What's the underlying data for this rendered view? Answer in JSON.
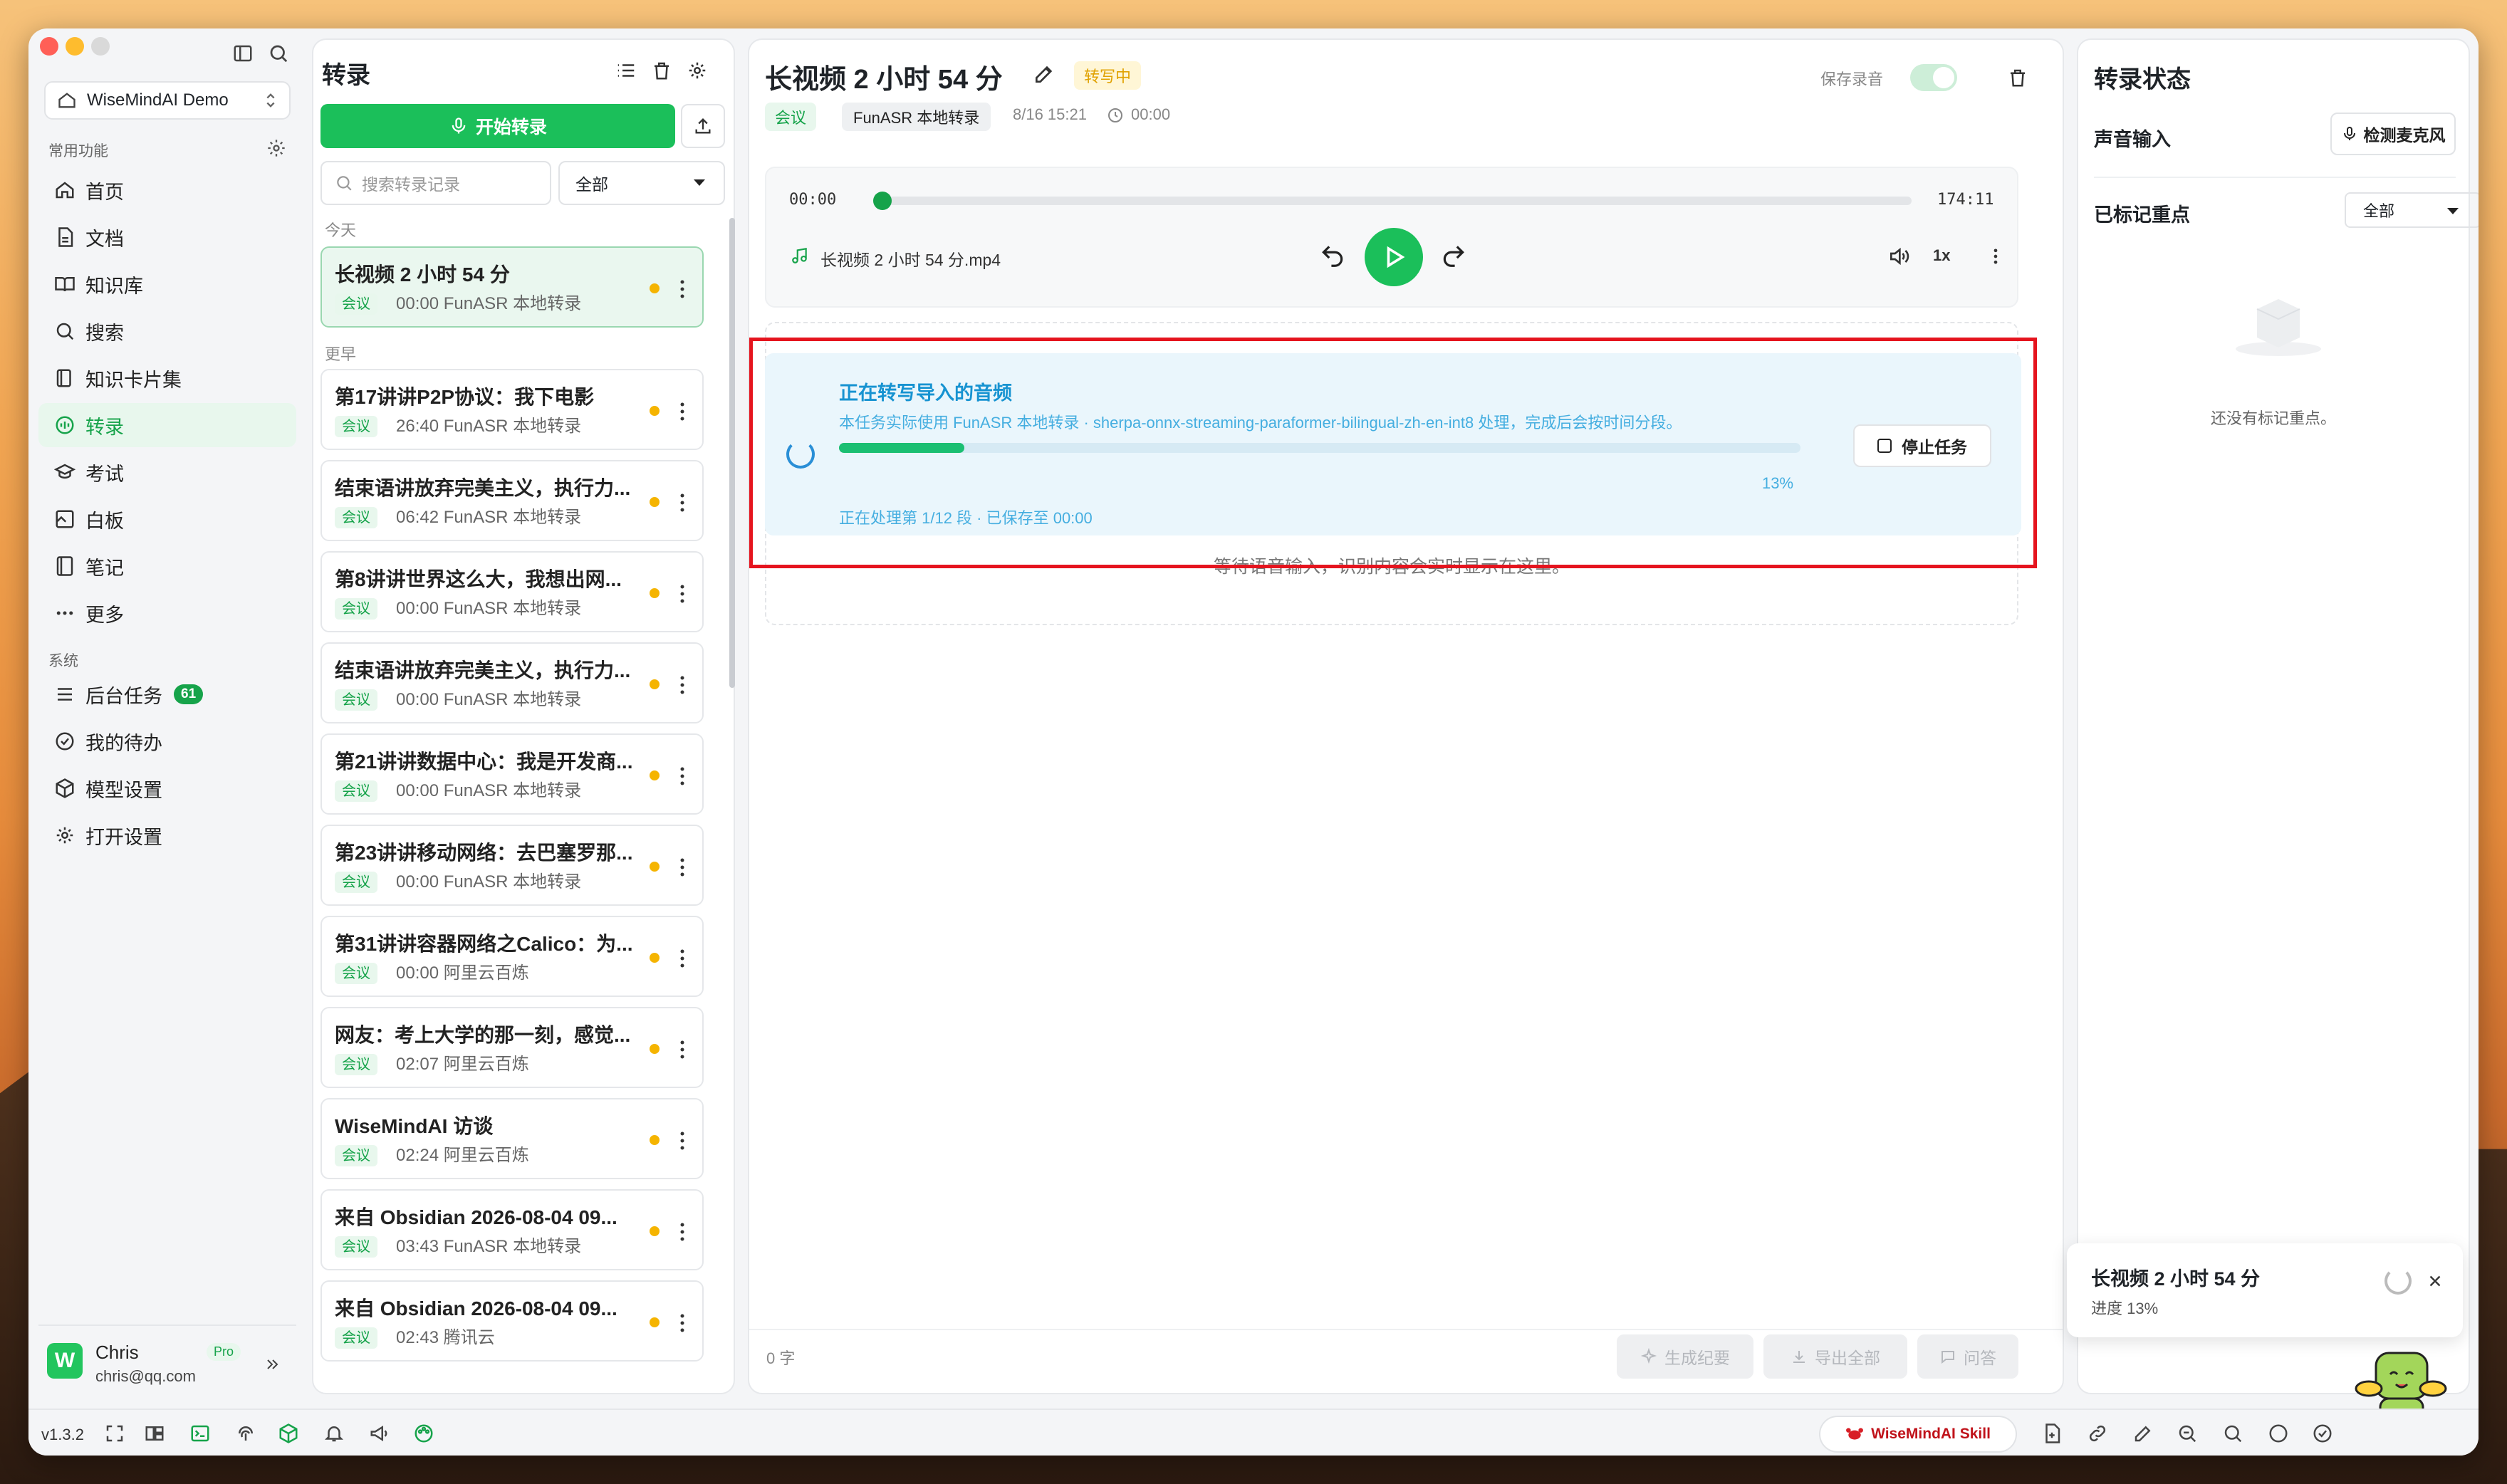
{
  "window": {
    "brand_colors": {
      "accent": "#16a34a",
      "highlight": "#e5141e",
      "warning": "#f5b400",
      "progress": "#1bbf72"
    }
  },
  "sidebar": {
    "workspace": "WiseMindAI Demo",
    "section_common": "常用功能",
    "items": [
      {
        "label": "首页",
        "icon": "home-icon"
      },
      {
        "label": "文档",
        "icon": "document-icon"
      },
      {
        "label": "知识库",
        "icon": "book-icon"
      },
      {
        "label": "搜索",
        "icon": "search-icon"
      },
      {
        "label": "知识卡片集",
        "icon": "card-icon"
      },
      {
        "label": "转录",
        "icon": "transcribe-icon",
        "active": true
      },
      {
        "label": "考试",
        "icon": "exam-icon"
      },
      {
        "label": "白板",
        "icon": "whiteboard-icon"
      },
      {
        "label": "笔记",
        "icon": "notebook-icon"
      },
      {
        "label": "更多",
        "icon": "more-icon"
      }
    ],
    "section_system": "系统",
    "system_items": [
      {
        "label": "后台任务",
        "icon": "list-icon",
        "badge": "61"
      },
      {
        "label": "我的待办",
        "icon": "check-circle-icon"
      },
      {
        "label": "模型设置",
        "icon": "cube-icon"
      },
      {
        "label": "打开设置",
        "icon": "gear-icon"
      }
    ],
    "user": {
      "name": "Chris",
      "email": "chris@qq.com",
      "plan": "Pro"
    }
  },
  "list": {
    "title": "转录",
    "start_button": "开始转录",
    "search_placeholder": "搜索转录记录",
    "filter": "全部",
    "group_today": "今天",
    "group_earlier": "更早",
    "today": [
      {
        "title": "长视频 2 小时 54 分",
        "tag": "会议",
        "meta": "00:00   FunASR 本地转录"
      }
    ],
    "earlier": [
      {
        "title": "第17讲讲P2P协议：我下电影",
        "tag": "会议",
        "meta": "26:40   FunASR 本地转录"
      },
      {
        "title": "结束语讲放弃完美主义，执行力...",
        "tag": "会议",
        "meta": "06:42   FunASR 本地转录"
      },
      {
        "title": "第8讲讲世界这么大，我想出网...",
        "tag": "会议",
        "meta": "00:00   FunASR 本地转录"
      },
      {
        "title": "结束语讲放弃完美主义，执行力...",
        "tag": "会议",
        "meta": "00:00   FunASR 本地转录"
      },
      {
        "title": "第21讲讲数据中心：我是开发商...",
        "tag": "会议",
        "meta": "00:00   FunASR 本地转录"
      },
      {
        "title": "第23讲讲移动网络：去巴塞罗那...",
        "tag": "会议",
        "meta": "00:00   FunASR 本地转录"
      },
      {
        "title": "第31讲讲容器网络之Calico：为...",
        "tag": "会议",
        "meta": "00:00   阿里云百炼"
      },
      {
        "title": "网友：考上大学的那一刻，感觉...",
        "tag": "会议",
        "meta": "02:07   阿里云百炼"
      },
      {
        "title": "WiseMindAI 访谈",
        "tag": "会议",
        "meta": "02:24   阿里云百炼"
      },
      {
        "title": "来自 Obsidian 2026-08-04 09...",
        "tag": "会议",
        "meta": "03:43   FunASR 本地转录"
      },
      {
        "title": "来自 Obsidian 2026-08-04 09...",
        "tag": "会议",
        "meta": "02:43   腾讯云"
      }
    ]
  },
  "main": {
    "title": "长视频 2 小时 54 分",
    "status": "转写中",
    "tag": "会议",
    "engine": "FunASR 本地转录",
    "date": "8/16 15:21",
    "duration": "00:00",
    "save_audio_label": "保存录音",
    "player": {
      "current": "00:00",
      "total": "174:11",
      "file": "长视频 2 小时 54 分.mp4",
      "speed": "1x",
      "progress": 0.0
    },
    "task": {
      "title": "正在转写导入的音频",
      "desc": "本任务实际使用 FunASR 本地转录 · sherpa-onnx-streaming-paraformer-bilingual-zh-en-int8 处理，完成后会按时间分段。",
      "percent_text": "13%",
      "progress": 0.13,
      "detail": "正在处理第 1/12 段 · 已保存至 00:00",
      "stop": "停止任务"
    },
    "waiting": "等待语音输入，识别内容会实时显示在这里。",
    "word_count": "0 字",
    "actions": [
      "生成纪要",
      "导出全部",
      "问答"
    ]
  },
  "right": {
    "title": "转录状态",
    "voice_input": "声音输入",
    "detect_mic": "检测麦克风",
    "marked": "已标记重点",
    "marked_filter": "全部",
    "empty": "还没有标记重点。",
    "toast_title": "长视频 2 小时 54 分",
    "toast_progress": "进度 13%"
  },
  "bottom": {
    "version": "v1.3.2",
    "skill": "WiseMindAI Skill"
  }
}
